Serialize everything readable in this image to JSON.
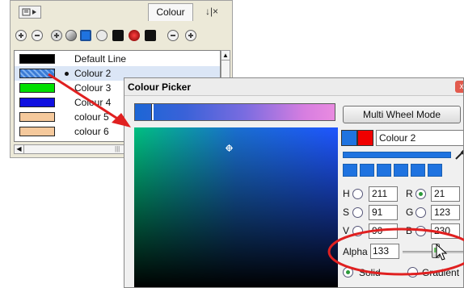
{
  "colour_panel": {
    "tab_label": "Colour",
    "tab_controls": "↓|×",
    "colours": [
      {
        "name": "Default Line",
        "swatch": "#000000"
      },
      {
        "name": "Colour 2",
        "swatch": "#3a7bd5"
      },
      {
        "name": "Colour 3",
        "swatch": "#00e000"
      },
      {
        "name": "Colour 4",
        "swatch": "#1010e0"
      },
      {
        "name": "colour 5",
        "swatch": "#f5c99c"
      },
      {
        "name": "colour 6",
        "swatch": "#f5c99c"
      }
    ],
    "toolbar_icons": [
      "add-colour-icon",
      "remove-colour-icon",
      "add-texture-icon",
      "edit-gradient-icon",
      "swatch-mode-icon",
      "pencil-icon",
      "black-swatch-icon",
      "dark-red-swatch-icon",
      "black-swatch-icon",
      "link-icon",
      "scroll-icon"
    ]
  },
  "picker": {
    "title": "Colour Picker",
    "close_label": "x",
    "multiwheel_label": "Multi Wheel Mode",
    "colour_name": "Colour 2",
    "h_label": "H",
    "h_value": "211",
    "s_label": "S",
    "s_value": "91",
    "v_label": "V",
    "v_value": "90",
    "r_label": "R",
    "r_value": "21",
    "g_label": "G",
    "g_value": "123",
    "b_label": "B",
    "b_value": "230",
    "alpha_label": "Alpha",
    "alpha_value": "133",
    "solid_label": "Solid",
    "gradient_label": "Gradient"
  },
  "colors": {
    "current": "#1f73e0",
    "secondary": "#f00000",
    "annotation": "#e02020"
  }
}
